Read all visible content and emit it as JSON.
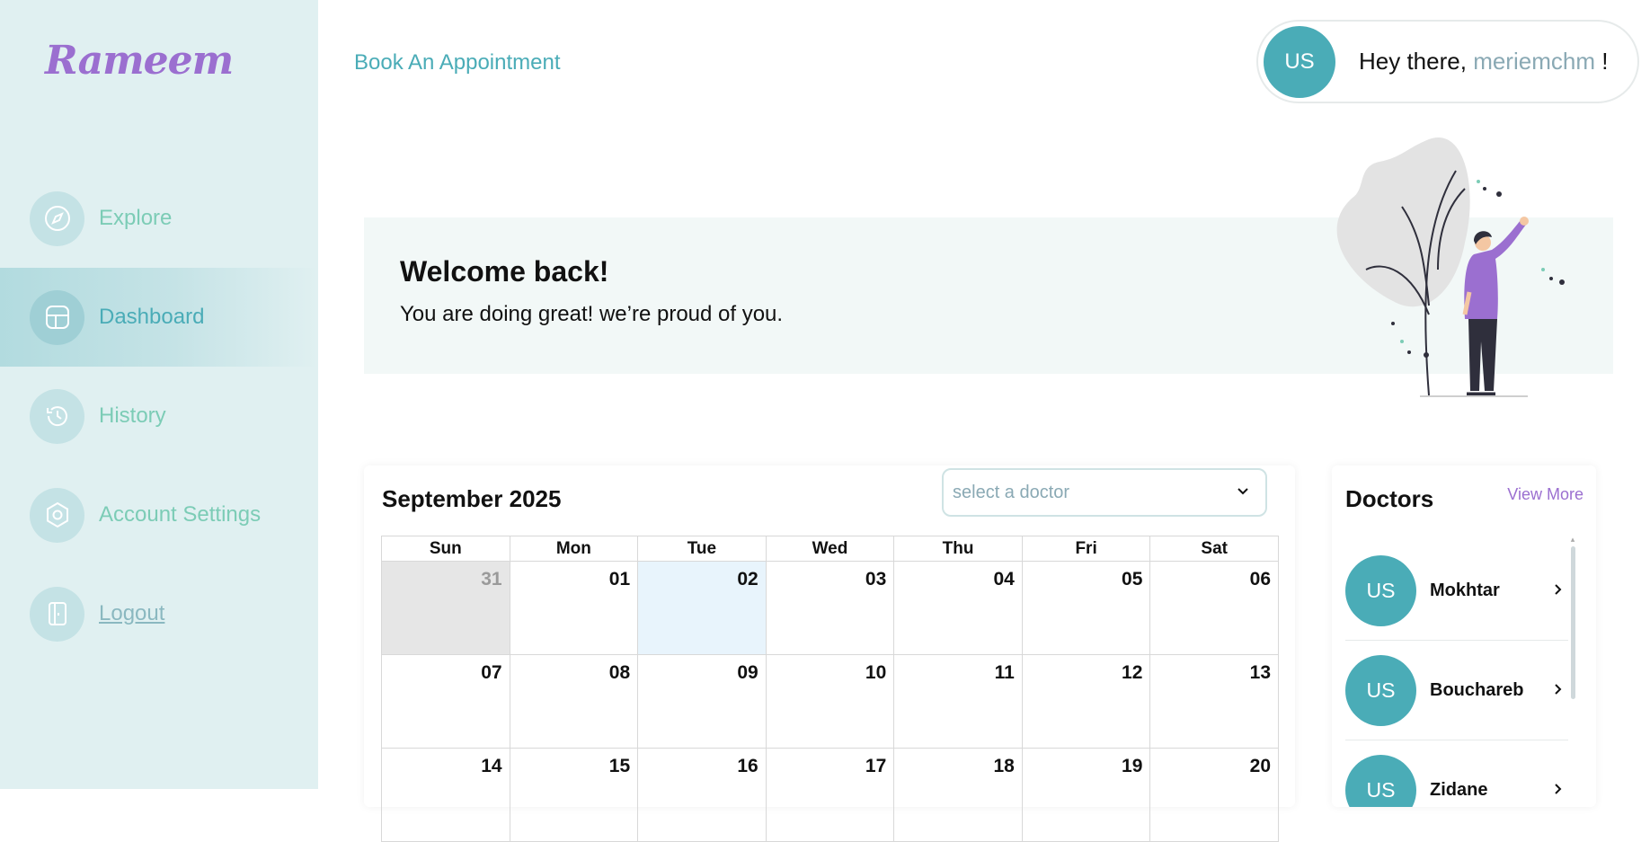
{
  "app": {
    "logo": "Rameem"
  },
  "colors": {
    "brand_purple": "#9b6fd0",
    "teal": "#4aacb7",
    "mint": "#7cccb6",
    "sidebar_bg": "#e0f0f1"
  },
  "sidebar": {
    "items": [
      {
        "label": "Explore",
        "icon": "compass-icon",
        "active": false
      },
      {
        "label": "Dashboard",
        "icon": "dashboard-layout-icon",
        "active": true
      },
      {
        "label": "History",
        "icon": "history-icon",
        "active": false
      },
      {
        "label": "Account Settings",
        "icon": "settings-icon",
        "active": false
      },
      {
        "label": "Logout",
        "icon": "logout-door-icon",
        "active": false
      }
    ]
  },
  "header": {
    "book_link": "Book An Appointment",
    "avatar_initials": "US",
    "greeting_prefix": "Hey there,",
    "username": "meriemchm",
    "greeting_suffix": "!"
  },
  "welcome": {
    "title": "Welcome back!",
    "subtitle": "You are doing great! we’re proud of you."
  },
  "calendar": {
    "month_title": "September 2025",
    "doctor_select_placeholder": "select a doctor",
    "weekdays": [
      "Sun",
      "Mon",
      "Tue",
      "Wed",
      "Thu",
      "Fri",
      "Sat"
    ],
    "weeks": [
      [
        "31",
        "01",
        "02",
        "03",
        "04",
        "05",
        "06"
      ],
      [
        "07",
        "08",
        "09",
        "10",
        "11",
        "12",
        "13"
      ],
      [
        "14",
        "15",
        "16",
        "17",
        "18",
        "19",
        "20"
      ]
    ],
    "other_month_days": [
      "31"
    ],
    "today": "02"
  },
  "doctors": {
    "title": "Doctors",
    "view_more": "View More",
    "list": [
      {
        "initials": "US",
        "name": "Mokhtar"
      },
      {
        "initials": "US",
        "name": "Bouchareb"
      },
      {
        "initials": "US",
        "name": "Zidane"
      }
    ]
  }
}
